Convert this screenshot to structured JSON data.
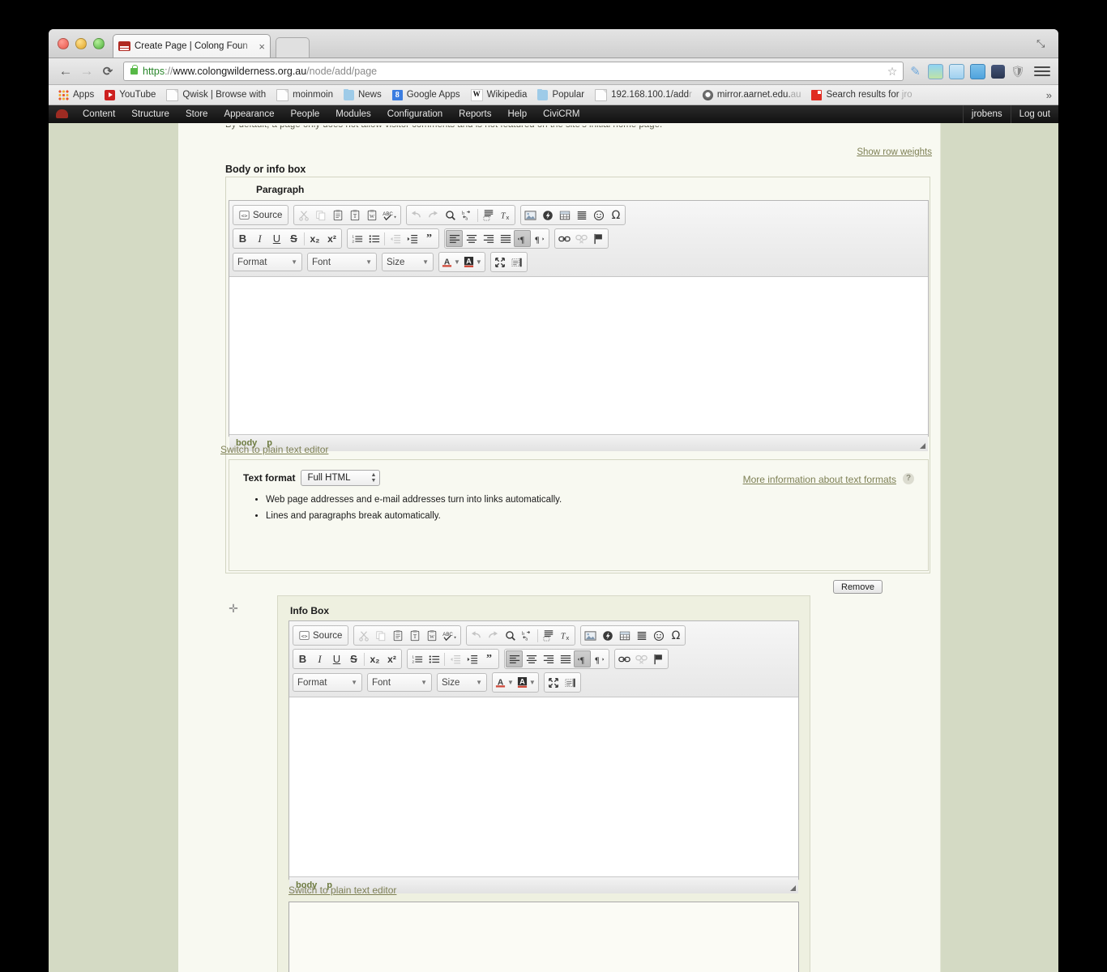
{
  "window": {
    "tab_title": "Create Page | Colong Foun",
    "tab_close": "×",
    "expand_icon": "⤡"
  },
  "nav": {
    "back": "←",
    "forward": "→",
    "reload": "⟳",
    "url_scheme": "https",
    "url_sep": "://",
    "url_host": "www.colongwilderness.org.au",
    "url_path": "/node/add/page",
    "star": "☆",
    "menu": "menu-icon"
  },
  "bookmarks": {
    "items": [
      {
        "label": "Apps",
        "icon": "apps-grid-icon",
        "faded": ""
      },
      {
        "label": "YouTube",
        "icon": "youtube-icon",
        "faded": ""
      },
      {
        "label": "Qwisk | Browse with",
        "icon": "document-icon",
        "faded": ""
      },
      {
        "label": "moinmoin",
        "icon": "document-icon",
        "faded": ""
      },
      {
        "label": "News",
        "icon": "folder-icon",
        "faded": ""
      },
      {
        "label": "Google Apps",
        "icon": "google-icon",
        "faded": ""
      },
      {
        "label": "Wikipedia",
        "icon": "wikipedia-icon",
        "faded": ""
      },
      {
        "label": "Popular",
        "icon": "folder-icon",
        "faded": ""
      },
      {
        "label": "192.168.100.1/add",
        "icon": "document-icon",
        "faded": "r"
      },
      {
        "label": "mirror.aarnet.edu.",
        "icon": "mirror-icon",
        "faded": "au"
      },
      {
        "label": "Search results for ",
        "icon": "red-square-icon",
        "faded": "jro"
      }
    ],
    "overflow": "»"
  },
  "admin_bar": {
    "logo": "drupal-logo-icon",
    "items": [
      "Content",
      "Structure",
      "Store",
      "Appearance",
      "People",
      "Modules",
      "Configuration",
      "Reports",
      "Help",
      "CiviCRM"
    ],
    "user": "jrobens",
    "logout": "Log out"
  },
  "page": {
    "clipped_help": "By default, a page only does not allow visitor comments and is not featured on the site's initial home page.",
    "show_row_weights": "Show row weights",
    "section_label": "Body or info box",
    "remove_label": "Remove",
    "drag_handle": "✛"
  },
  "editor_toolbar": {
    "source_label": "Source",
    "row1": [
      {
        "group": "source",
        "buttons": [
          {
            "name": "source-button",
            "label": "Source",
            "icon": "source-icon",
            "state": "normal"
          }
        ]
      },
      {
        "group": "clipboard",
        "buttons": [
          {
            "name": "cut-button",
            "label": "Cut",
            "icon": "scissors-icon",
            "state": "disabled"
          },
          {
            "name": "copy-button",
            "label": "Copy",
            "icon": "copy-icon",
            "state": "disabled"
          },
          {
            "name": "paste-button",
            "label": "Paste",
            "icon": "clipboard-icon",
            "state": "normal"
          },
          {
            "name": "paste-text-button",
            "label": "Paste as plain text",
            "icon": "clipboard-text-icon",
            "state": "normal"
          },
          {
            "name": "paste-word-button",
            "label": "Paste from Word",
            "icon": "clipboard-word-icon",
            "state": "normal"
          },
          {
            "name": "spellcheck-button",
            "label": "Spell Check As You Type",
            "icon": "abc-check-icon",
            "state": "normal"
          }
        ]
      },
      {
        "group": "history",
        "buttons": [
          {
            "name": "undo-button",
            "label": "Undo",
            "icon": "undo-arrow-icon",
            "state": "disabled"
          },
          {
            "name": "redo-button",
            "label": "Redo",
            "icon": "redo-arrow-icon",
            "state": "disabled"
          },
          {
            "name": "find-button",
            "label": "Find",
            "icon": "magnifier-icon",
            "state": "normal"
          },
          {
            "name": "replace-button",
            "label": "Replace",
            "icon": "replace-ba-icon",
            "state": "normal"
          },
          {
            "name": "select-all-button",
            "label": "Select All",
            "icon": "select-all-icon",
            "state": "normal"
          },
          {
            "name": "remove-format-button",
            "label": "Remove Format",
            "icon": "remove-format-icon",
            "state": "normal"
          }
        ]
      },
      {
        "group": "insert",
        "buttons": [
          {
            "name": "image-button",
            "label": "Image",
            "icon": "image-icon",
            "state": "normal"
          },
          {
            "name": "flash-button",
            "label": "Flash",
            "icon": "flash-icon",
            "state": "normal"
          },
          {
            "name": "table-button",
            "label": "Table",
            "icon": "table-icon",
            "state": "normal"
          },
          {
            "name": "horizontal-rule-button",
            "label": "Horizontal Line",
            "icon": "horizontal-rule-icon",
            "state": "normal"
          },
          {
            "name": "smiley-button",
            "label": "Smiley",
            "icon": "smiley-icon",
            "state": "normal"
          },
          {
            "name": "special-char-button",
            "label": "Special Character",
            "icon": "omega-icon",
            "state": "normal"
          }
        ]
      }
    ],
    "row2": [
      {
        "group": "basicstyles",
        "buttons": [
          {
            "name": "bold-button",
            "label": "B",
            "icon": "bold-icon",
            "state": "normal"
          },
          {
            "name": "italic-button",
            "label": "I",
            "icon": "italic-icon",
            "state": "normal"
          },
          {
            "name": "underline-button",
            "label": "U",
            "icon": "underline-icon",
            "state": "normal"
          },
          {
            "name": "strike-button",
            "label": "S",
            "icon": "strikethrough-icon",
            "state": "normal"
          },
          {
            "name": "subscript-button",
            "label": "x₂",
            "icon": "subscript-icon",
            "state": "normal"
          },
          {
            "name": "superscript-button",
            "label": "x²",
            "icon": "superscript-icon",
            "state": "normal"
          }
        ]
      },
      {
        "group": "paragraph",
        "buttons": [
          {
            "name": "numbered-list-button",
            "label": "Insert/Remove Numbered List",
            "icon": "numbered-list-icon",
            "state": "normal"
          },
          {
            "name": "bulleted-list-button",
            "label": "Insert/Remove Bulleted List",
            "icon": "bulleted-list-icon",
            "state": "normal"
          },
          {
            "name": "outdent-button",
            "label": "Decrease Indent",
            "icon": "outdent-icon",
            "state": "disabled"
          },
          {
            "name": "indent-button",
            "label": "Increase Indent",
            "icon": "indent-icon",
            "state": "normal"
          },
          {
            "name": "blockquote-button",
            "label": "Block Quote",
            "icon": "blockquote-icon",
            "state": "normal"
          }
        ]
      },
      {
        "group": "align",
        "buttons": [
          {
            "name": "align-left-button",
            "label": "Align Left",
            "icon": "align-left-icon",
            "state": "active"
          },
          {
            "name": "align-center-button",
            "label": "Center",
            "icon": "align-center-icon",
            "state": "normal"
          },
          {
            "name": "align-right-button",
            "label": "Align Right",
            "icon": "align-right-icon",
            "state": "normal"
          },
          {
            "name": "justify-button",
            "label": "Justify",
            "icon": "justify-icon",
            "state": "normal"
          },
          {
            "name": "ltr-button",
            "label": "Text direction left to right",
            "icon": "ltr-icon",
            "state": "active"
          },
          {
            "name": "rtl-button",
            "label": "Text direction right to left",
            "icon": "rtl-icon",
            "state": "normal"
          }
        ]
      },
      {
        "group": "links",
        "buttons": [
          {
            "name": "link-button",
            "label": "Link",
            "icon": "link-icon",
            "state": "normal"
          },
          {
            "name": "unlink-button",
            "label": "Unlink",
            "icon": "unlink-icon",
            "state": "disabled"
          },
          {
            "name": "anchor-button",
            "label": "Anchor",
            "icon": "flag-anchor-icon",
            "state": "normal"
          }
        ]
      }
    ],
    "row3": {
      "format": "Format",
      "font": "Font",
      "size": "Size",
      "text_color": "text-color-icon",
      "bg_color": "background-color-icon",
      "maximize": "maximize-icon",
      "show_blocks": "show-blocks-icon"
    },
    "path": [
      "body",
      "p"
    ],
    "resizer": "resize-handle-icon"
  },
  "paragraph_field": {
    "title": "Paragraph",
    "switch_link": "Switch to plain text editor",
    "text_format": {
      "label": "Text format",
      "value": "Full HTML",
      "more_info": "More information about text formats",
      "help_icon": "?",
      "tips": [
        "Web page addresses and e-mail addresses turn into links automatically.",
        "Lines and paragraphs break automatically."
      ]
    }
  },
  "infobox_field": {
    "title": "Info Box",
    "switch_link": "Switch to plain text editor"
  }
}
